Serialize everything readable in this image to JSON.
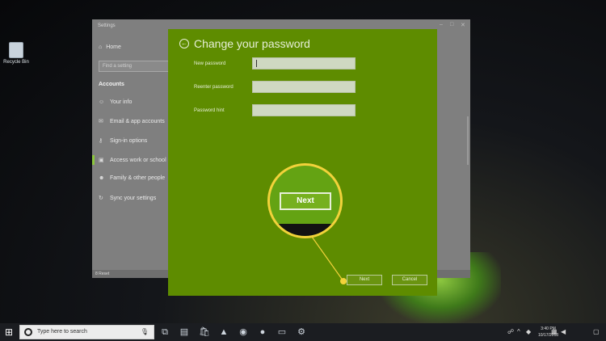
{
  "desktop": {
    "recycle_bin_label": "Recycle Bin"
  },
  "settings": {
    "window_title": "Settings",
    "home_label": "Home",
    "find_placeholder": "Find a setting",
    "section_label": "Accounts",
    "nav": [
      {
        "label": "Your info",
        "icon": "person-icon"
      },
      {
        "label": "Email & app accounts",
        "icon": "mail-icon"
      },
      {
        "label": "Sign-in options",
        "icon": "key-icon"
      },
      {
        "label": "Access work or school",
        "icon": "briefcase-icon"
      },
      {
        "label": "Family & other people",
        "icon": "people-icon"
      },
      {
        "label": "Sync your settings",
        "icon": "sync-icon"
      }
    ],
    "status_strip": "8 Reset"
  },
  "dialog": {
    "title": "Change your password",
    "fields": [
      {
        "label": "New password",
        "value": ""
      },
      {
        "label": "Reenter password",
        "value": ""
      },
      {
        "label": "Password hint",
        "value": ""
      }
    ],
    "next_label": "Next",
    "cancel_label": "Cancel",
    "accent_color": "#5e8c00"
  },
  "callout": {
    "zoomed_next_label": "Next",
    "highlight_color": "#f2d23a"
  },
  "taskbar": {
    "search_placeholder": "Type here to search",
    "clock_time": "3:40 PM",
    "clock_date": "10/17/2018"
  }
}
